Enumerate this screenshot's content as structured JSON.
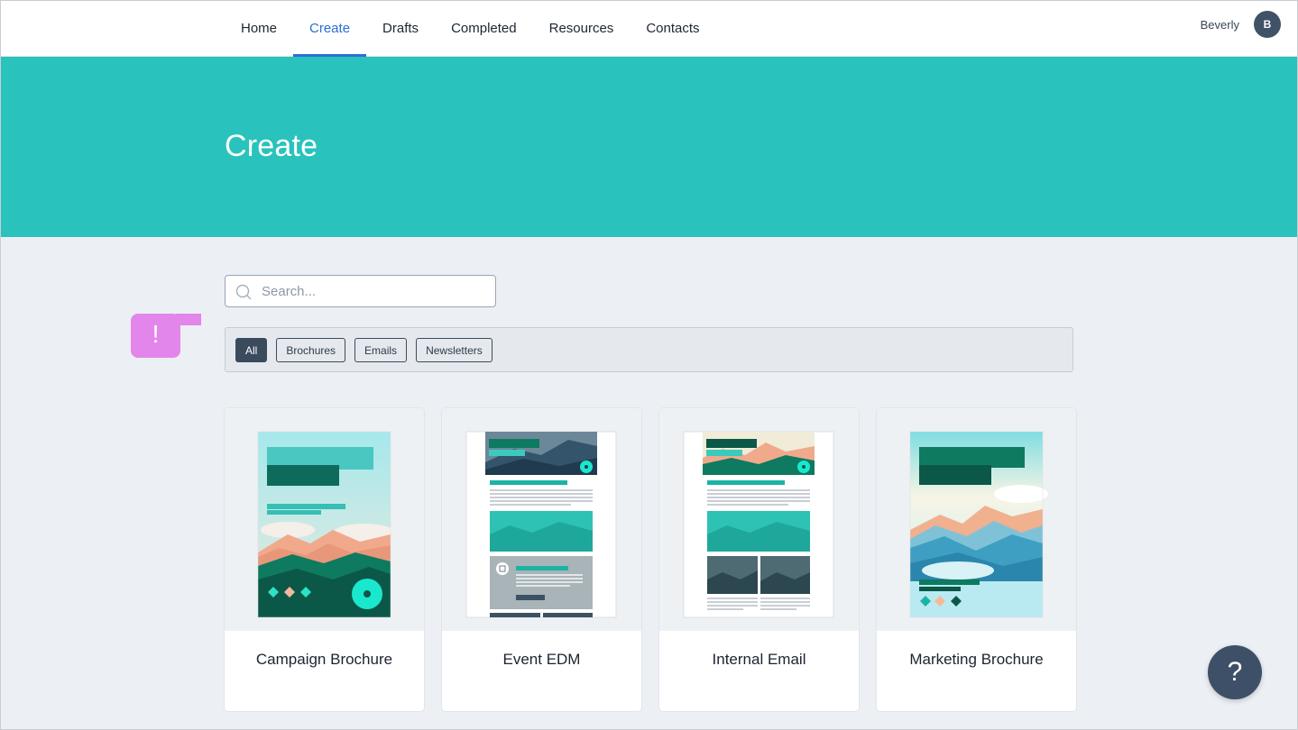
{
  "nav": {
    "items": [
      {
        "label": "Home"
      },
      {
        "label": "Create"
      },
      {
        "label": "Drafts"
      },
      {
        "label": "Completed"
      },
      {
        "label": "Resources"
      },
      {
        "label": "Contacts"
      }
    ],
    "active": "Create"
  },
  "user": {
    "name": "Beverly",
    "initial": "B"
  },
  "hero": {
    "title": "Create"
  },
  "search": {
    "placeholder": "Search..."
  },
  "filters": {
    "chips": [
      {
        "label": "All",
        "active": true
      },
      {
        "label": "Brochures",
        "active": false
      },
      {
        "label": "Emails",
        "active": false
      },
      {
        "label": "Newsletters",
        "active": false
      }
    ]
  },
  "flag": {
    "text": "!"
  },
  "cards": [
    {
      "title": "Campaign Brochure"
    },
    {
      "title": "Event EDM"
    },
    {
      "title": "Internal Email"
    },
    {
      "title": "Marketing Brochure"
    }
  ],
  "help": {
    "label": "?"
  },
  "colors": {
    "accent": "#2a6fd6",
    "hero": "#2ac2bc",
    "dark": "#3b4b5e",
    "flag": "#e386ec"
  }
}
